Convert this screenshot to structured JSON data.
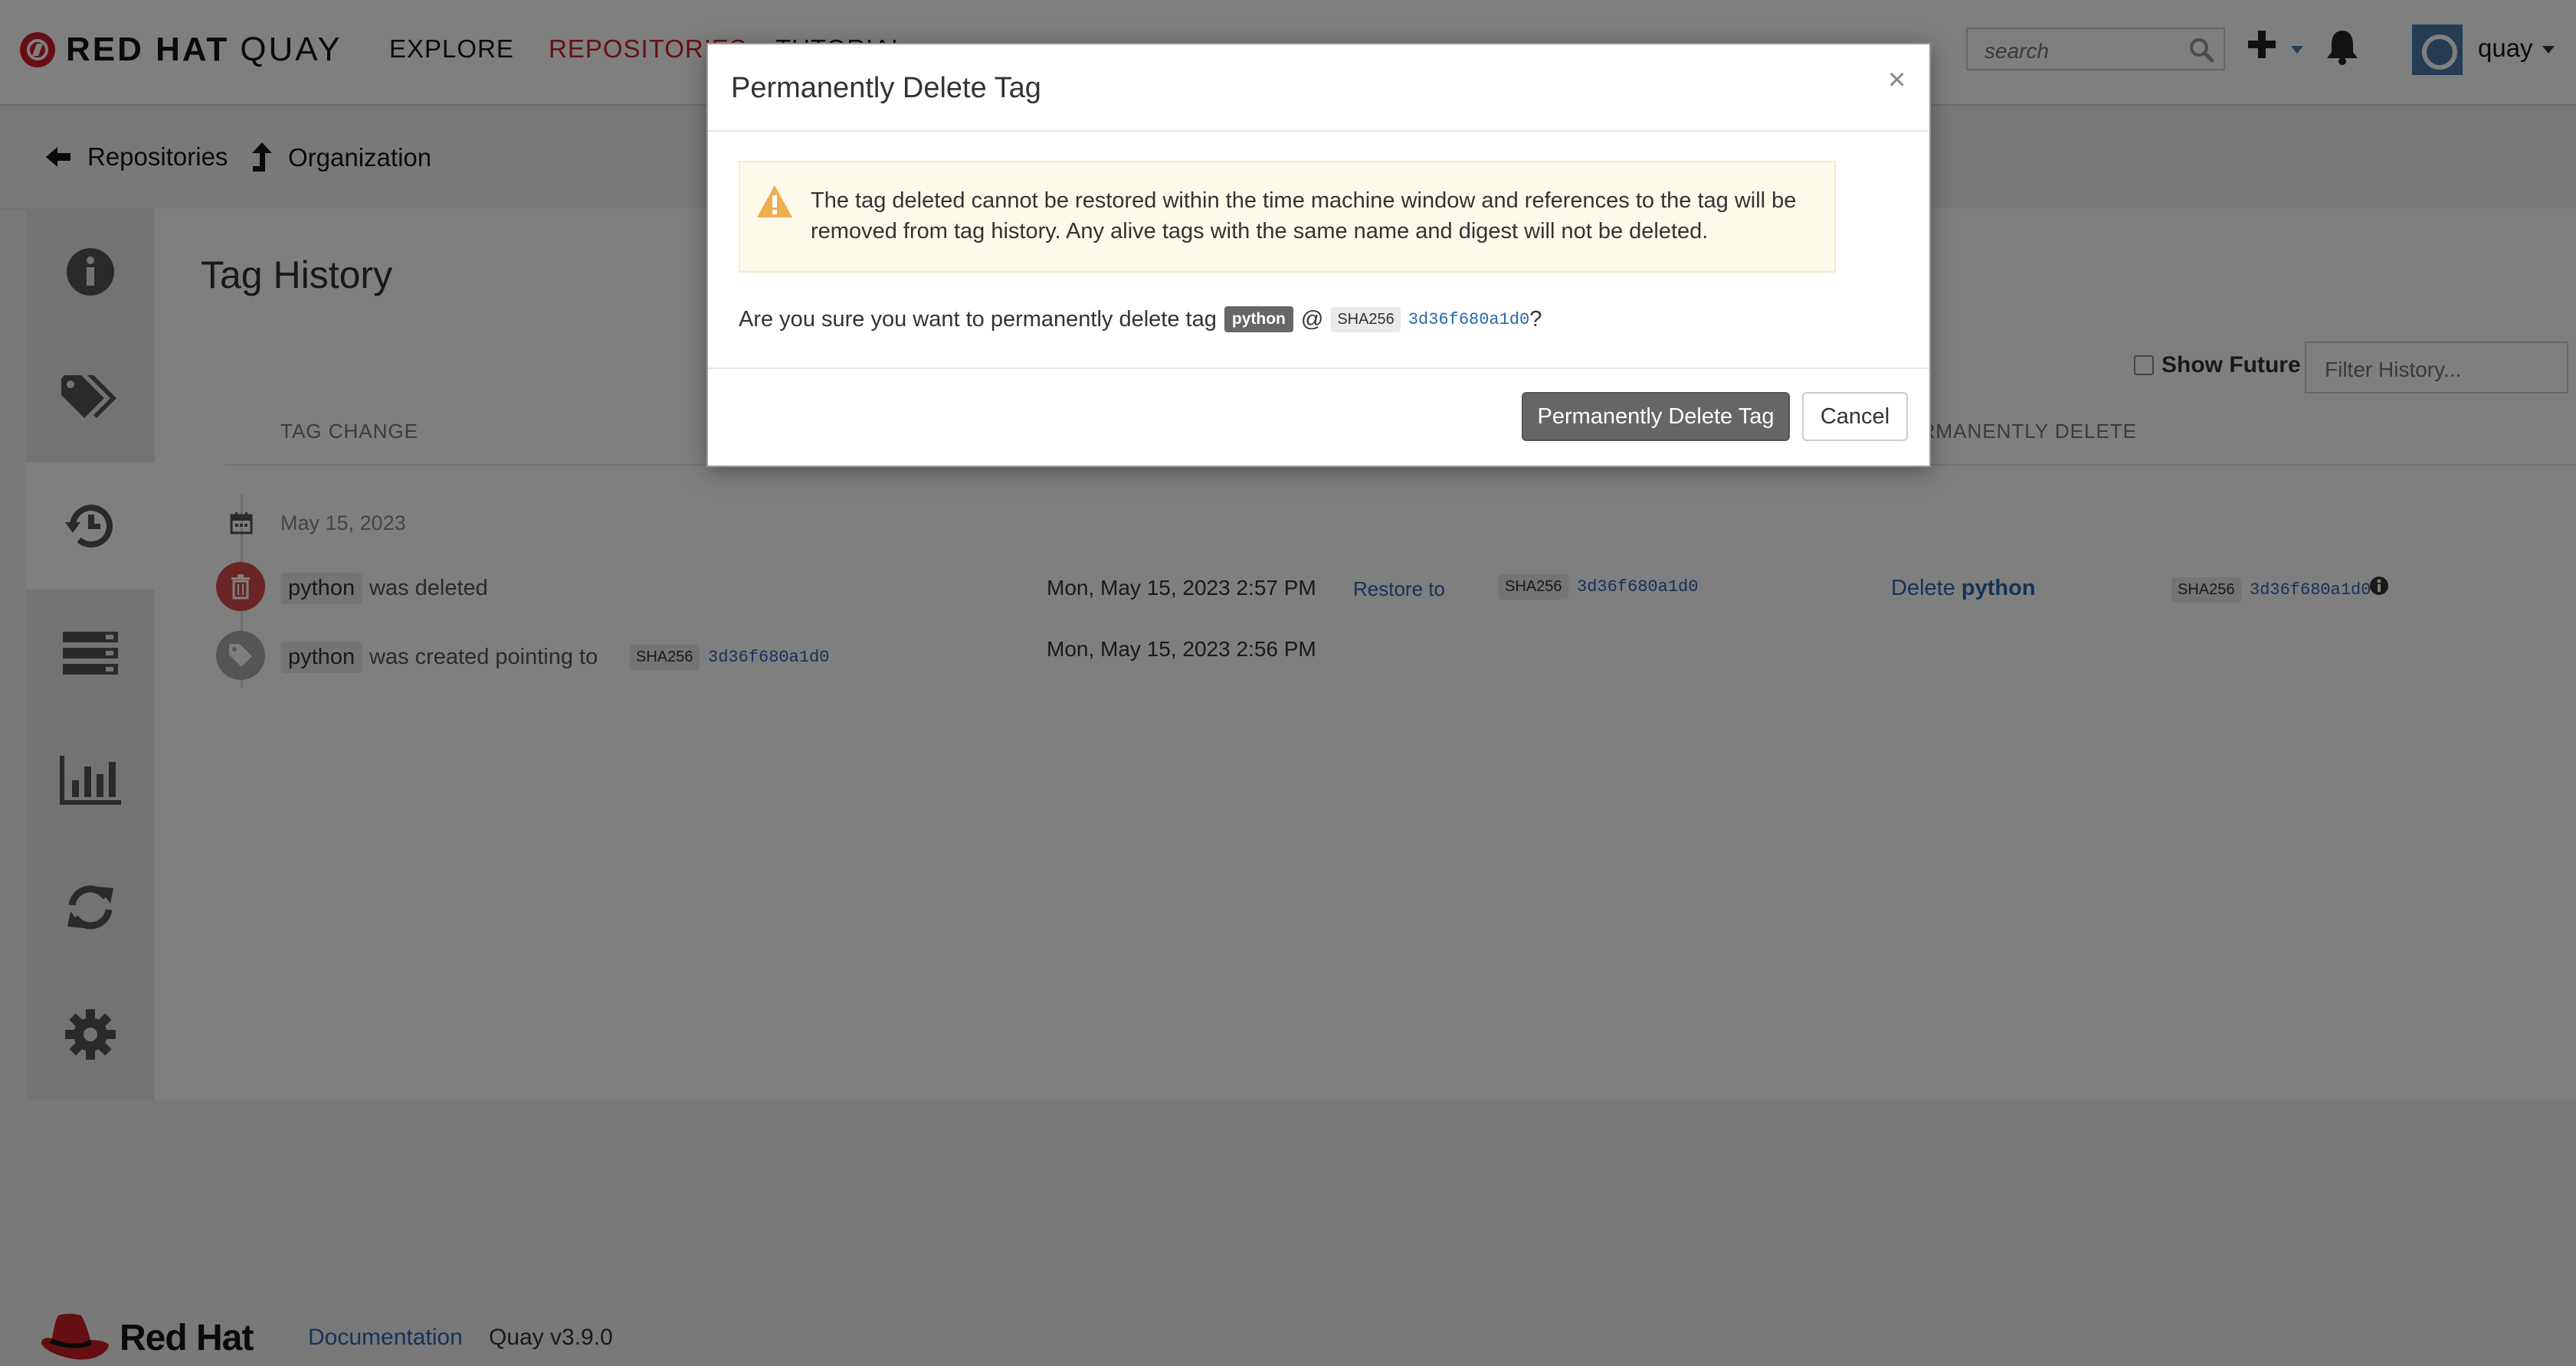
{
  "header": {
    "logo_bold": "RED HAT",
    "logo_product": "QUAY",
    "nav": [
      {
        "label": "EXPLORE"
      },
      {
        "label": "REPOSITORIES"
      },
      {
        "label": "TUTORIAL"
      }
    ],
    "search_placeholder": "search",
    "username": "quay"
  },
  "breadcrumb": {
    "back_label": "Repositories",
    "up_label": "Organization"
  },
  "sidebar": {
    "items": [
      {
        "icon": "info-icon"
      },
      {
        "icon": "tags-icon"
      },
      {
        "icon": "history-icon",
        "active": true
      },
      {
        "icon": "builds-icon"
      },
      {
        "icon": "usage-chart-icon"
      },
      {
        "icon": "mirror-sync-icon"
      },
      {
        "icon": "settings-gear-icon"
      }
    ]
  },
  "main": {
    "title": "Tag History",
    "show_future_label": "Show Future",
    "filter_placeholder": "Filter History...",
    "columns": {
      "tag_change": "TAG CHANGE",
      "permanently_delete": "PERMANENTLY DELETE"
    },
    "date_group": "May 15, 2023",
    "events": [
      {
        "tag": "python",
        "action": "was deleted",
        "time": "Mon, May 15, 2023 2:57 PM",
        "restore_label": "Restore to",
        "sha_label": "SHA256",
        "digest": "3d36f680a1d0",
        "delete_prefix": "Delete",
        "delete_tag": "python"
      },
      {
        "tag": "python",
        "action": "was created pointing to",
        "sha_label": "SHA256",
        "digest": "3d36f680a1d0",
        "time": "Mon, May 15, 2023 2:56 PM"
      }
    ]
  },
  "modal": {
    "title": "Permanently Delete Tag",
    "close_glyph": "×",
    "warning": "The tag deleted cannot be restored within the time machine window and references to the tag will be removed from tag history. Any alive tags with the same name and digest will not be deleted.",
    "question_prefix": "Are you sure you want to permanently delete tag",
    "tag": "python",
    "at": "@",
    "sha_label": "SHA256",
    "digest": "3d36f680a1d0",
    "question_suffix": "?",
    "confirm_label": "Permanently Delete Tag",
    "cancel_label": "Cancel"
  },
  "footer": {
    "brand": "Red Hat",
    "doc_link": "Documentation",
    "version": "Quay v3.9.0"
  },
  "colors": {
    "brand_red": "#cc1f27",
    "link_blue": "#2b66b0",
    "warning_bg": "#fefaeb",
    "warning_icon": "#f0ad4e",
    "danger_button": "#666666"
  }
}
